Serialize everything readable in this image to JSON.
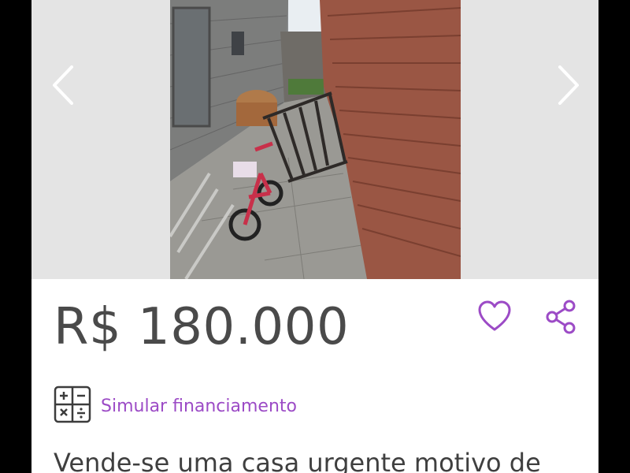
{
  "listing": {
    "price": "R$ 180.000",
    "financing_label": "Simular financiamento",
    "description": "Vende-se uma casa urgente motivo de",
    "photo_alt": "Foto do imóvel"
  },
  "icons": {
    "prev": "chevron-left-icon",
    "next": "chevron-right-icon",
    "favorite": "heart-icon",
    "share": "share-icon",
    "financing": "calculator-icon"
  },
  "colors": {
    "accent": "#9c4bc6",
    "price_text": "#4a4a4a",
    "gallery_bg": "#e4e4e4"
  }
}
